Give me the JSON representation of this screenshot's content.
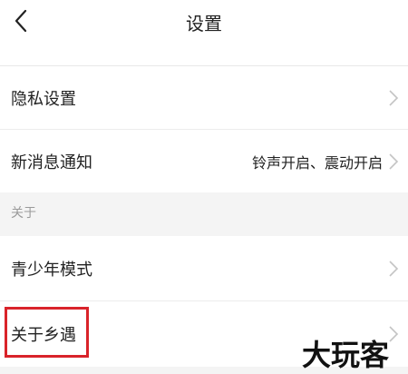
{
  "header": {
    "title": "设置"
  },
  "rows": [
    {
      "label": "隐私设置",
      "value": ""
    },
    {
      "label": "新消息通知",
      "value": "铃声开启、震动开启"
    }
  ],
  "section": {
    "label": "关于"
  },
  "about_rows": [
    {
      "label": "青少年模式"
    },
    {
      "label": "关于乡遇"
    }
  ],
  "watermark": {
    "text": "大玩客"
  },
  "colors": {
    "highlight": "#d9232a",
    "background": "#f4f4f4",
    "chevron": "#c4c4c4"
  }
}
